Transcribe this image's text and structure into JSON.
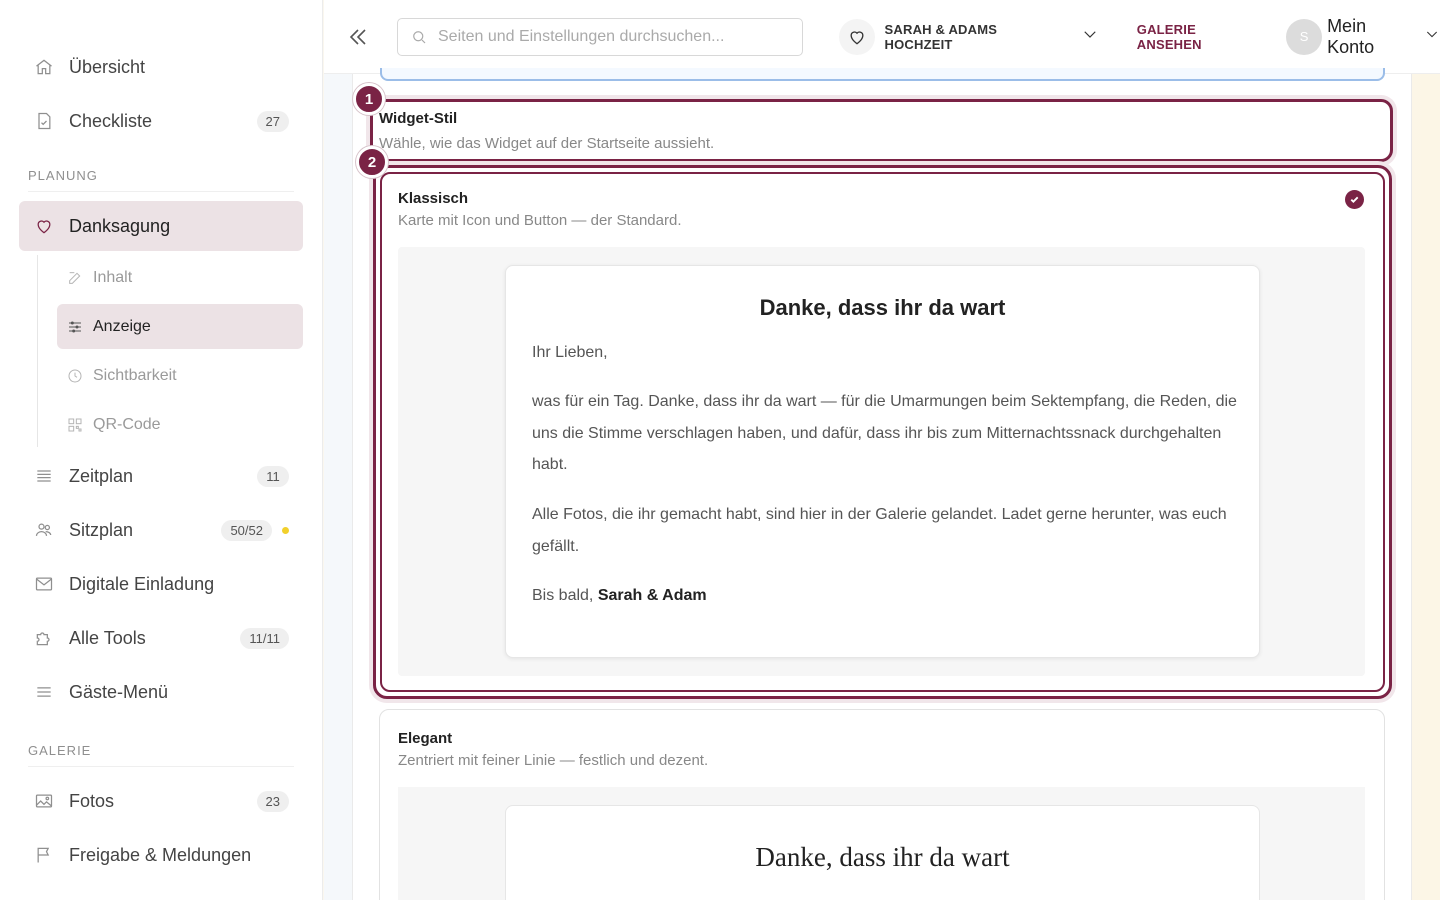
{
  "sidebar": {
    "items_top": [
      {
        "label": "Übersicht",
        "badge": ""
      },
      {
        "label": "Checkliste",
        "badge": "27"
      }
    ],
    "section_planung": "PLANUNG",
    "active_item": {
      "label": "Danksagung"
    },
    "subitems": [
      {
        "label": "Inhalt"
      },
      {
        "label": "Anzeige"
      },
      {
        "label": "Sichtbarkeit"
      },
      {
        "label": "QR-Code"
      }
    ],
    "items_planung": [
      {
        "label": "Zeitplan",
        "badge": "11"
      },
      {
        "label": "Sitzplan",
        "badge": "50/52"
      },
      {
        "label": "Digitale Einladung",
        "badge": ""
      },
      {
        "label": "Alle Tools",
        "badge": "11/11"
      },
      {
        "label": "Gäste-Menü",
        "badge": ""
      }
    ],
    "section_galerie": "GALERIE",
    "items_galerie": [
      {
        "label": "Fotos",
        "badge": "23"
      },
      {
        "label": "Freigabe & Meldungen",
        "badge": ""
      }
    ]
  },
  "header": {
    "search_placeholder": "Seiten und Einstellungen durchsuchen...",
    "event_name": "SARAH & ADAMS HOCHZEIT",
    "gallery_link": "GALERIE ANSEHEN",
    "avatar_initial": "S",
    "account_label": "Mein Konto"
  },
  "main": {
    "markers": [
      "1",
      "2"
    ],
    "widget_style": {
      "title": "Widget-Stil",
      "subtitle": "Wähle, wie das Widget auf der Startseite aussieht."
    },
    "options": [
      {
        "title": "Klassisch",
        "subtitle": "Karte mit Icon und Button — der Standard.",
        "selected": true,
        "preview": {
          "heading": "Danke, dass ihr da wart",
          "greeting": "Ihr Lieben,",
          "paragraph1": "was für ein Tag. Danke, dass ihr da wart — für die Umarmungen beim Sektempfang, die Reden, die uns die Stimme verschlagen haben, und dafür, dass ihr bis zum Mitternachtssnack durchgehalten habt.",
          "paragraph2": "Alle Fotos, die ihr gemacht habt, sind hier in der Galerie gelandet. Ladet gerne herunter, was euch gefällt.",
          "closing": "Bis bald, ",
          "signature": "Sarah & Adam"
        }
      },
      {
        "title": "Elegant",
        "subtitle": "Zentriert mit feiner Linie — festlich und dezent.",
        "selected": false,
        "preview": {
          "heading": "Danke, dass ihr da wart"
        }
      }
    ]
  },
  "colors": {
    "accent": "#7a2345",
    "active_bg": "#ece2e5",
    "status_dot": "#f2d02b"
  }
}
